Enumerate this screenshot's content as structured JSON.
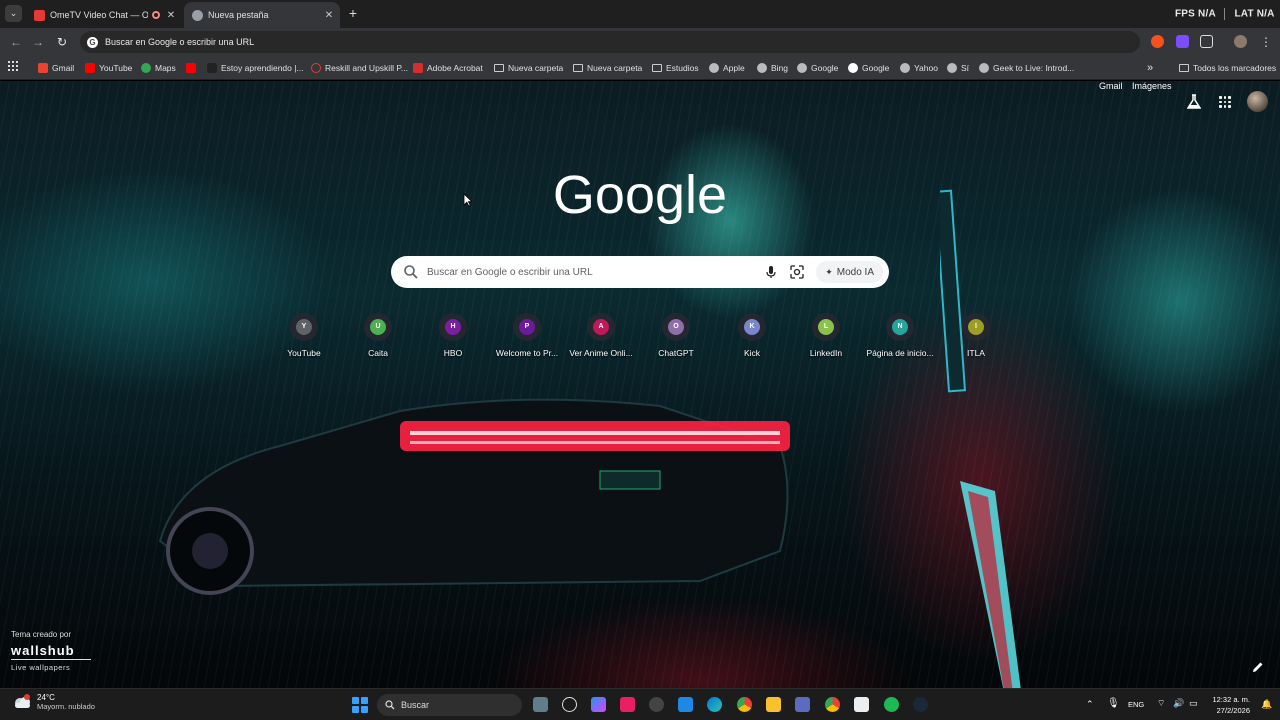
{
  "browser": {
    "tabs": [
      {
        "title": "OmeTV Video Chat — Ome",
        "favicon_color": "#e53935",
        "recording": true
      },
      {
        "title": "Nueva pestaña",
        "favicon_color": "#9aa0a6",
        "active": true
      }
    ],
    "overlay_left": "FPS",
    "overlay_left_value": "N/A",
    "overlay_right": "LAT",
    "overlay_right_value": "N/A",
    "address_placeholder": "Buscar en Google o escribir una URL"
  },
  "bookmarks": [
    {
      "label": "Gmail",
      "icon": "gmail-icon",
      "color": "#ea4335"
    },
    {
      "label": "YouTube",
      "icon": "youtube-icon",
      "color": "#ff0000"
    },
    {
      "label": "Maps",
      "icon": "maps-icon",
      "color": "#34a853"
    },
    {
      "label": "",
      "icon": "youtube-icon",
      "color": "#ff0000"
    },
    {
      "label": "Estoy aprendiendo |...",
      "icon": "site-icon",
      "color": "#222222"
    },
    {
      "label": "Reskill and Upskill P...",
      "icon": "site-icon",
      "color": "#e53935"
    },
    {
      "label": "Adobe Acrobat",
      "icon": "acrobat-icon",
      "color": "#d32f2f"
    },
    {
      "label": "Nueva carpeta",
      "icon": "folder-icon",
      "color": ""
    },
    {
      "label": "Nueva carpeta",
      "icon": "folder-icon",
      "color": ""
    },
    {
      "label": "Estudios",
      "icon": "folder-icon",
      "color": ""
    },
    {
      "label": "Apple",
      "icon": "globe-icon",
      "color": "#bbbbbb"
    },
    {
      "label": "Bing",
      "icon": "globe-icon",
      "color": "#bbbbbb"
    },
    {
      "label": "Google",
      "icon": "globe-icon",
      "color": "#bbbbbb"
    },
    {
      "label": "Google",
      "icon": "google-icon",
      "color": "#ffffff"
    },
    {
      "label": "Yahoo",
      "icon": "globe-icon",
      "color": "#bbbbbb"
    },
    {
      "label": "Sí",
      "icon": "globe-icon",
      "color": "#bbbbbb"
    },
    {
      "label": "Geek to Live: Introd...",
      "icon": "globe-icon",
      "color": "#bbbbbb"
    }
  ],
  "bookmarks_more": "»",
  "all_bookmarks": "Todos los marcadores",
  "ntp": {
    "gmail": "Gmail",
    "images": "Imágenes",
    "logo": "Google",
    "search_placeholder": "Buscar en Google o escribir una URL",
    "ai_mode": "Modo IA",
    "shortcuts": [
      {
        "letter": "Y",
        "label": "YouTube",
        "color": "#5f6368"
      },
      {
        "letter": "U",
        "label": "Caita",
        "color": "#4caf50"
      },
      {
        "letter": "H",
        "label": "HBO",
        "color": "#7b1fa2"
      },
      {
        "letter": "P",
        "label": "Welcome to Pr...",
        "color": "#6a1b9a"
      },
      {
        "letter": "A",
        "label": "Ver Anime Onli...",
        "color": "#c2185b"
      },
      {
        "letter": "O",
        "label": "ChatGPT",
        "color": "#8e6fa8"
      },
      {
        "letter": "K",
        "label": "Kick",
        "color": "#7986cb"
      },
      {
        "letter": "L",
        "label": "LinkedIn",
        "color": "#8bc34a"
      },
      {
        "letter": "N",
        "label": "Página de inicio...",
        "color": "#26a69a"
      },
      {
        "letter": "I",
        "label": "ITLA",
        "color": "#9e9d24"
      }
    ],
    "theme_credit": "Tema creado por",
    "theme_brand": "wallshub",
    "theme_sub": "Live wallpapers"
  },
  "taskbar": {
    "temperature": "24°C",
    "weather": "Mayorm. nublado",
    "search_placeholder": "Buscar",
    "language": "ENG",
    "time": "12:32 a. m.",
    "date": "27/2/2026"
  }
}
